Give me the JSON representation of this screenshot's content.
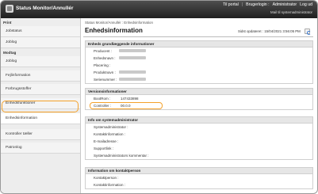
{
  "app": {
    "title": "Status Monitor/Annullér"
  },
  "topnav": {
    "links": [
      "Til portal",
      "Brugerlogin :",
      "Administrator",
      "Log ud"
    ],
    "mail": "Mail til systemadministrator"
  },
  "sidebar": {
    "print_header": "Print",
    "print_items": [
      "Jobstatus",
      "Joblog"
    ],
    "device_header": "Modtag",
    "device_items": [
      "Joblog",
      "Fejlinformation",
      "Forbrugsstoffer",
      "Enhedsfunktioner",
      "Enhedsinformation",
      "Kontroller tæller",
      "Patronlog"
    ],
    "selected": "Enhedsinformation"
  },
  "main": {
    "breadcrumb": "Status Monitor/Annullér : Enhedsinformation",
    "title": "Enhedsinformation",
    "updated": "Sidst opdateret : 15/04/2021 3:56:05 PM",
    "sections": [
      {
        "header": "Enheds grundlæggende informationer",
        "rows": [
          {
            "label": "Producent :",
            "redacted": true
          },
          {
            "label": "Enhedsnavn :",
            "redacted": true
          },
          {
            "label": "Placering :",
            "redacted": false,
            "value": ""
          },
          {
            "label": "Produktnavn :",
            "redacted": true
          },
          {
            "label": "Serienummer :",
            "redacted": true
          }
        ]
      },
      {
        "header": "Versionsinformationer",
        "rows": [
          {
            "label": "BootRom :",
            "value": "147433898"
          },
          {
            "label": "Controller :",
            "value": "00.0.0"
          }
        ]
      },
      {
        "header": "Info om systemadministrator",
        "rows": [
          {
            "label": "Systemadministrator :",
            "value": ""
          },
          {
            "label": "Kontaktinformation :",
            "value": ""
          },
          {
            "label": "E-mailadresse :",
            "value": ""
          },
          {
            "label": "Supportlink :",
            "value": ""
          },
          {
            "label": "Systemadministrators kommentar :",
            "value": ""
          }
        ]
      },
      {
        "header": "Information om kontaktperson",
        "rows": [
          {
            "label": "Kontaktperson :",
            "value": ""
          },
          {
            "label": "Kontaktinformation :",
            "value": ""
          }
        ]
      }
    ]
  },
  "colors": {
    "highlight": "#f4a12a",
    "topbar": "#2a2a2a"
  }
}
